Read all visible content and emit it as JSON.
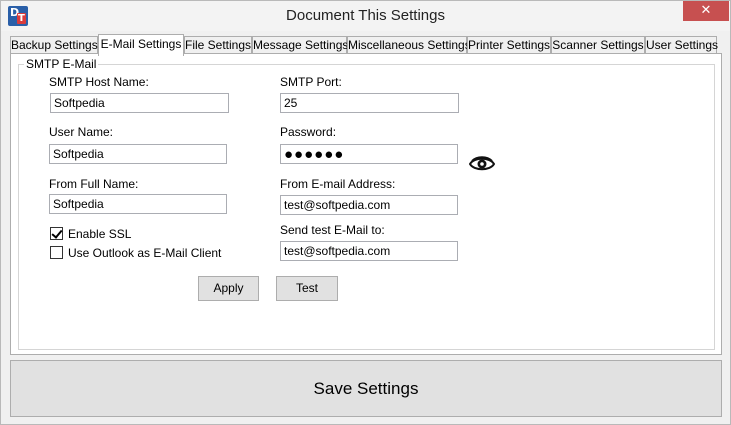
{
  "window": {
    "title": "Document This Settings",
    "close_glyph": "✕",
    "icon_letters": [
      "D",
      "T"
    ]
  },
  "tabs": [
    {
      "label": "Backup Settings",
      "active": false
    },
    {
      "label": "E-Mail Settings",
      "active": true
    },
    {
      "label": "File Settings",
      "active": false
    },
    {
      "label": "Message Settings",
      "active": false
    },
    {
      "label": "Miscellaneous Settings",
      "active": false
    },
    {
      "label": "Printer Settings",
      "active": false
    },
    {
      "label": "Scanner Settings",
      "active": false
    },
    {
      "label": "User Settings",
      "active": false
    }
  ],
  "smtp": {
    "group_title": "SMTP E-Mail",
    "host_label": "SMTP Host Name:",
    "host_value": "Softpedia",
    "port_label": "SMTP Port:",
    "port_value": "25",
    "user_label": "User Name:",
    "user_value": "Softpedia",
    "password_label": "Password:",
    "password_value": "●●●●●●",
    "fullname_label": "From Full Name:",
    "fullname_value": "Softpedia",
    "from_address_label": "From E-mail Address:",
    "from_address_value": "test@softpedia.com",
    "ssl_label": "Enable SSL",
    "ssl_checked": true,
    "outlook_label": "Use Outlook as E-Mail Client",
    "outlook_checked": false,
    "send_test_label": "Send test E-Mail to:",
    "send_test_value": "test@softpedia.com",
    "apply_label": "Apply",
    "test_label": "Test"
  },
  "footer": {
    "save_label": "Save Settings"
  },
  "colors": {
    "close_button": "#c75050",
    "icon_blue": "#2a5fa8",
    "icon_red": "#d93b3b"
  }
}
